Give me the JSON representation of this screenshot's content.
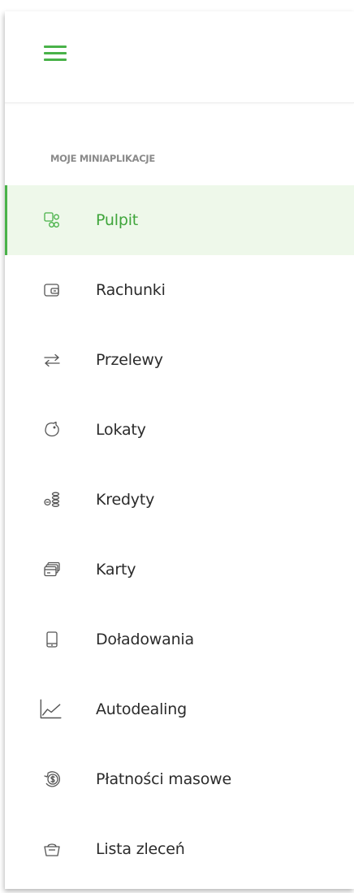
{
  "colors": {
    "accent": "#49b249",
    "active_background": "#eef8ea",
    "icon": "#555555",
    "text": "#2b2b2b",
    "section_title": "#8a8a8a"
  },
  "header": {
    "menu_icon": "hamburger-menu-icon"
  },
  "sidebar": {
    "section_title": "MOJE MINIAPLIKACJE",
    "active_item": "Pulpit",
    "items": [
      {
        "label": "Pulpit",
        "icon": "dashboard-icon"
      },
      {
        "label": "Rachunki",
        "icon": "wallet-icon"
      },
      {
        "label": "Przelewy",
        "icon": "transfer-arrows-icon"
      },
      {
        "label": "Lokaty",
        "icon": "piggy-bank-icon"
      },
      {
        "label": "Kredyty",
        "icon": "coins-icon"
      },
      {
        "label": "Karty",
        "icon": "cards-icon"
      },
      {
        "label": "Doładowania",
        "icon": "mobile-phone-icon"
      },
      {
        "label": "Autodealing",
        "icon": "chart-line-icon"
      },
      {
        "label": "Płatności masowe",
        "icon": "dollar-coin-icon"
      },
      {
        "label": "Lista zleceń",
        "icon": "basket-icon"
      }
    ]
  }
}
